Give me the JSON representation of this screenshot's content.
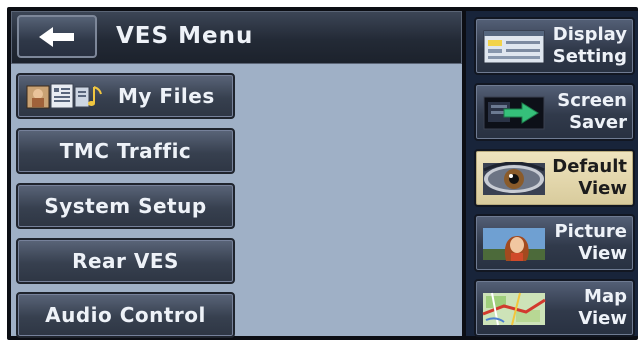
{
  "header": {
    "title": "VES Menu"
  },
  "main_menu": {
    "items": [
      {
        "label": "My Files"
      },
      {
        "label": "TMC Traffic"
      },
      {
        "label": "System Setup"
      },
      {
        "label": "Rear VES"
      },
      {
        "label": "Audio Control"
      }
    ]
  },
  "side_menu": {
    "items": [
      {
        "line1": "Display",
        "line2": "Setting",
        "icon": "display-setting-icon"
      },
      {
        "line1": "Screen",
        "line2": "Saver",
        "icon": "screen-saver-icon"
      },
      {
        "line1": "Default",
        "line2": "View",
        "icon": "eye-icon",
        "selected": true
      },
      {
        "line1": "Picture",
        "line2": "View",
        "icon": "portrait-icon"
      },
      {
        "line1": "Map",
        "line2": "View",
        "icon": "map-icon"
      }
    ]
  },
  "colors": {
    "panel_bg": "#9fb0c6",
    "frame_bg": "#0c0e14",
    "button_dark": "#37404f",
    "selected_bg": "#e6dab0",
    "text_light": "#eef2f8"
  }
}
